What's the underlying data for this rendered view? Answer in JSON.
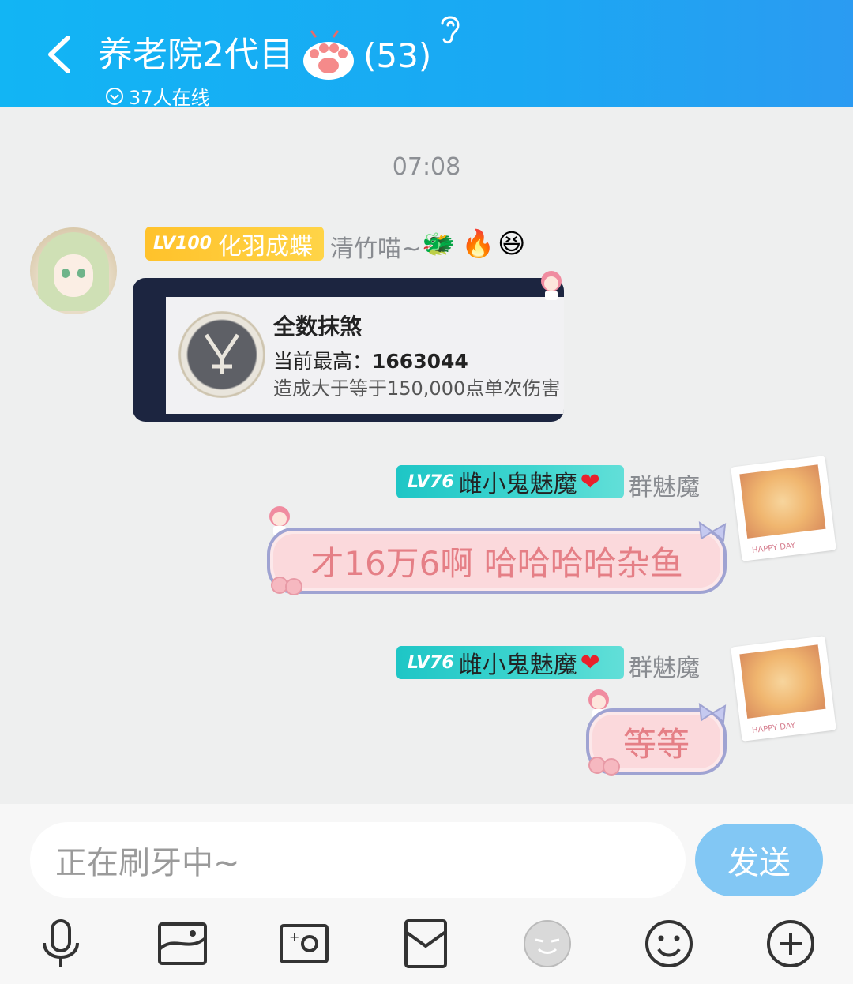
{
  "header": {
    "back_label": "",
    "title": "养老院2代目",
    "member_count": "(53)",
    "online_status": "37人在线"
  },
  "chat": {
    "timestamp": "07:08",
    "messages": [
      {
        "side": "left",
        "badge_level": "LV100",
        "badge_title": "化羽成蝶",
        "sender": "清竹喵~",
        "emojis": [
          "🐲",
          "🔥",
          "😆"
        ],
        "card": {
          "title": "全数抹煞",
          "best_label": "当前最高：",
          "best_value": "1663044",
          "description": "造成大于等于150,000点单次伤害"
        }
      },
      {
        "side": "right",
        "badge_level": "LV76",
        "badge_title": "雌小鬼魅魔",
        "heart": "❤",
        "sender": "群魅魔",
        "text": "才16万6啊 哈哈哈哈杂鱼",
        "avatar_caption": "HAPPY DAY"
      },
      {
        "side": "right",
        "badge_level": "LV76",
        "badge_title": "雌小鬼魅魔",
        "heart": "❤",
        "sender": "群魅魔",
        "text": "等等",
        "avatar_caption": "HAPPY DAY"
      }
    ]
  },
  "composer": {
    "input_value": "正在刷牙中~",
    "send_label": "发送",
    "toolbar_icons": [
      "microphone-icon",
      "image-icon",
      "camera-icon",
      "red-packet-icon",
      "sticker-face-icon",
      "emoji-icon",
      "plus-icon"
    ]
  },
  "colors": {
    "header_accent": "#12b5f4",
    "send_button": "#82c7f4",
    "bubble_fill": "#fbd9dc",
    "bubble_text": "#e57f86",
    "lv100_badge": "#ffc22b",
    "lv76_badge": "#1ec6c6"
  }
}
